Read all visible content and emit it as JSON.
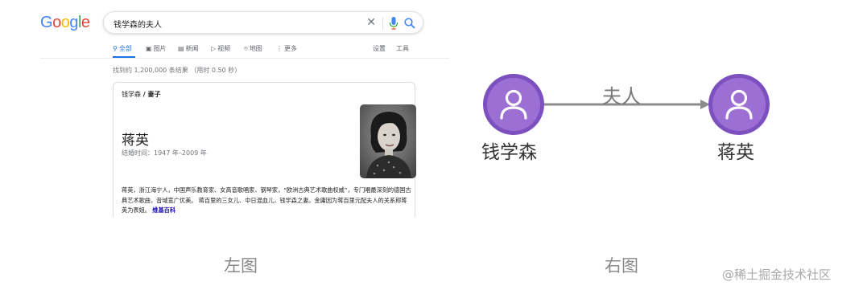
{
  "google": {
    "logo_letters": [
      {
        "ch": "G",
        "color": "#4285F4"
      },
      {
        "ch": "o",
        "color": "#EA4335"
      },
      {
        "ch": "o",
        "color": "#FBBC05"
      },
      {
        "ch": "g",
        "color": "#4285F4"
      },
      {
        "ch": "l",
        "color": "#34A853"
      },
      {
        "ch": "e",
        "color": "#EA4335"
      }
    ],
    "search": {
      "query": "钱学森的夫人",
      "clear_icon": "close-icon",
      "mic_icon": "mic-icon",
      "search_icon": "search-icon"
    },
    "tabs": [
      {
        "label": "全部",
        "icon": "search-icon",
        "glyph": "⚲",
        "active": true
      },
      {
        "label": "图片",
        "icon": "image-icon",
        "glyph": "▣",
        "active": false
      },
      {
        "label": "新闻",
        "icon": "news-icon",
        "glyph": "▤",
        "active": false
      },
      {
        "label": "视频",
        "icon": "video-icon",
        "glyph": "▷",
        "active": false
      },
      {
        "label": "地图",
        "icon": "map-pin-icon",
        "glyph": "⌾",
        "active": false
      },
      {
        "label": "更多",
        "icon": "more-icon",
        "glyph": "⋮",
        "active": false
      }
    ],
    "settings_label": "设置",
    "tools_label": "工具",
    "result_stats": "找到约 1,200,000 条结果 （用时 0.50 秒）",
    "knowledge_panel": {
      "breadcrumb_entity": "钱学森",
      "breadcrumb_separator": " / ",
      "breadcrumb_relation": "妻子",
      "title": "蒋英",
      "subtitle": "结婚时间：1947 年–2009 年",
      "description": "蒋英，浙江海宁人，中国声乐教育家、女高音歌唱家、钢琴家，“欧洲古典艺术歌曲权威”，专门唱最深刻的德国古典艺术歌曲，音域宽广优美。 蒋百里的三女儿、中日混血儿，钱学森之妻。金庸因为蒋百里元配夫人的关系称蒋英为表姐。",
      "source_link": "维基百科"
    }
  },
  "left_caption": "左图",
  "graph": {
    "node_color": "#9b6fd3",
    "node_ring_color": "#7d50c0",
    "edge_color": "#8c8c8c",
    "source_node": {
      "label": "钱学森",
      "icon": "user-icon"
    },
    "target_node": {
      "label": "蒋英",
      "icon": "user-icon"
    },
    "edge_label": "夫人"
  },
  "right_caption": "右图",
  "watermark": "@稀土掘金技术社区"
}
